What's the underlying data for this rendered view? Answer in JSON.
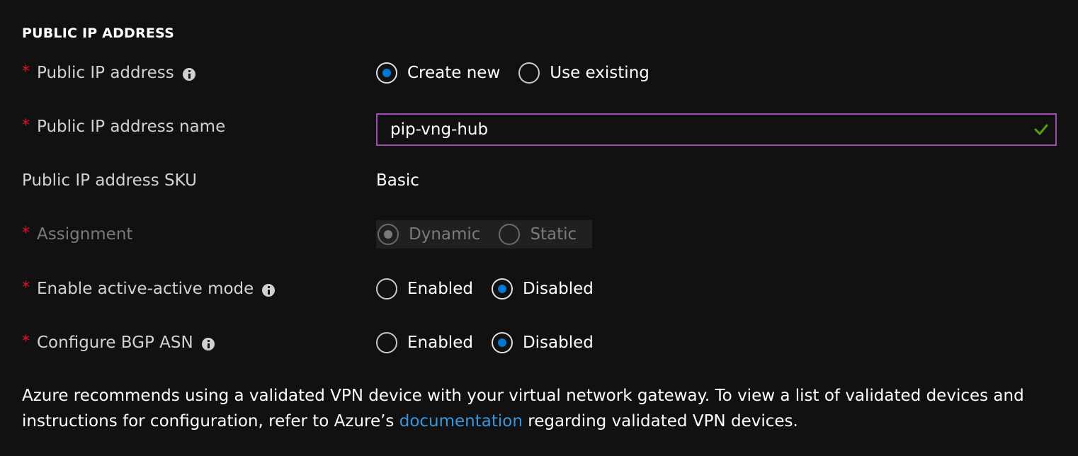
{
  "section": {
    "title": "PUBLIC IP ADDRESS"
  },
  "colors": {
    "background": "#111111",
    "required_asterisk": "#e81123",
    "radio_selected": "#0078d4",
    "input_border": "#a349b8",
    "valid_check": "#57a300",
    "link": "#3a96dd"
  },
  "fields": {
    "public_ip": {
      "label": "Public IP address",
      "required": "*",
      "options": [
        "Create new",
        "Use existing"
      ],
      "selected": "Create new"
    },
    "public_ip_name": {
      "label": "Public IP address name",
      "required": "*",
      "value": "pip-vng-hub",
      "valid_icon": "checkmark-icon"
    },
    "public_ip_sku": {
      "label": "Public IP address SKU",
      "value": "Basic"
    },
    "assignment": {
      "label": "Assignment",
      "required": "*",
      "options": [
        "Dynamic",
        "Static"
      ],
      "selected": "Dynamic",
      "disabled": true
    },
    "active_active": {
      "label": "Enable active-active mode",
      "required": "*",
      "options": [
        "Enabled",
        "Disabled"
      ],
      "selected": "Disabled"
    },
    "bgp_asn": {
      "label": "Configure BGP ASN",
      "required": "*",
      "options": [
        "Enabled",
        "Disabled"
      ],
      "selected": "Disabled"
    }
  },
  "note": {
    "text_before": "Azure recommends using a validated VPN device with your virtual network gateway. To view a list of validated devices and instructions for configuration, refer to Azure’s ",
    "link_text": "documentation",
    "text_after": " regarding validated VPN devices."
  }
}
